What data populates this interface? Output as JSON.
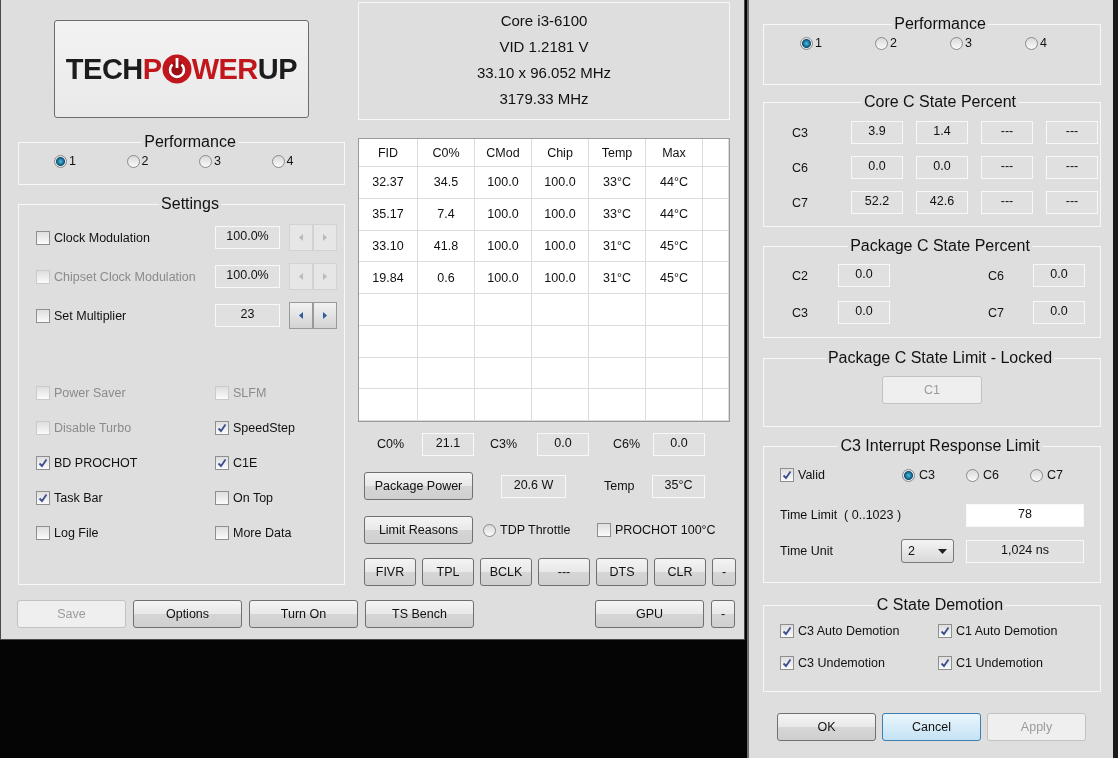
{
  "main_window": {
    "logo": {
      "left": [
        {
          "text": "TECH",
          "color": "#1c1c1c"
        },
        {
          "text": "P",
          "color": "#c1161c"
        }
      ],
      "right": [
        {
          "text": "WER",
          "color": "#c1161c"
        },
        {
          "text": "UP",
          "color": "#1c1c1c"
        }
      ]
    },
    "cpu_info": [
      "Core i3-6100",
      "VID  1.2181 V",
      "33.10 x 96.052 MHz",
      "3179.33 MHz"
    ],
    "performance": {
      "title": "Performance",
      "options": [
        {
          "label": "1",
          "selected": true
        },
        {
          "label": "2",
          "selected": false
        },
        {
          "label": "3",
          "selected": false
        },
        {
          "label": "4",
          "selected": false
        }
      ]
    },
    "settings": {
      "title": "Settings",
      "rows": [
        {
          "label": "Clock Modulation",
          "checked": false,
          "disabled": false,
          "value": "100.0%",
          "spinner_disabled": true
        },
        {
          "label": "Chipset Clock Modulation",
          "checked": false,
          "disabled": true,
          "value": "100.0%",
          "spinner_disabled": true
        },
        {
          "label": "Set Multiplier",
          "checked": false,
          "disabled": false,
          "value": "23",
          "spinner_disabled": false
        }
      ],
      "toggles": [
        {
          "label": "Power Saver",
          "checked": false,
          "disabled": true
        },
        {
          "label": "SLFM",
          "checked": false,
          "disabled": true
        },
        {
          "label": "Disable Turbo",
          "checked": false,
          "disabled": true
        },
        {
          "label": "SpeedStep",
          "checked": true,
          "disabled": false
        },
        {
          "label": "BD PROCHOT",
          "checked": true,
          "disabled": false
        },
        {
          "label": "C1E",
          "checked": true,
          "disabled": false
        },
        {
          "label": "Task Bar",
          "checked": true,
          "disabled": false
        },
        {
          "label": "On Top",
          "checked": false,
          "disabled": false
        },
        {
          "label": "Log File",
          "checked": false,
          "disabled": false
        },
        {
          "label": "More Data",
          "checked": false,
          "disabled": false
        }
      ]
    },
    "table": {
      "columns": [
        "FID",
        "C0%",
        "CMod",
        "Chip",
        "Temp",
        "Max"
      ],
      "rows": [
        [
          "32.37",
          "34.5",
          "100.0",
          "100.0",
          "33°C",
          "44°C"
        ],
        [
          "35.17",
          "7.4",
          "100.0",
          "100.0",
          "33°C",
          "44°C"
        ],
        [
          "33.10",
          "41.8",
          "100.0",
          "100.0",
          "31°C",
          "45°C"
        ],
        [
          "19.84",
          "0.6",
          "100.0",
          "100.0",
          "31°C",
          "45°C"
        ]
      ]
    },
    "summary": [
      {
        "label": "C0%",
        "value": "21.1"
      },
      {
        "label": "C3%",
        "value": "0.0"
      },
      {
        "label": "C6%",
        "value": "0.0"
      }
    ],
    "package_power": {
      "button": "Package Power",
      "value": "20.6 W",
      "temp_label": "Temp",
      "temp_value": "35°C"
    },
    "limit_reasons": {
      "button": "Limit Reasons",
      "tdp_throttle": {
        "label": "TDP Throttle",
        "selected": false
      },
      "prochot": {
        "label": "PROCHOT 100°C",
        "checked": false
      }
    },
    "tool_buttons": [
      "FIVR",
      "TPL",
      "BCLK",
      "---",
      "DTS",
      "CLR",
      "-"
    ],
    "bottom_buttons": [
      {
        "label": "Save",
        "disabled": true
      },
      {
        "label": "Options",
        "disabled": false
      },
      {
        "label": "Turn On",
        "disabled": false
      },
      {
        "label": "TS Bench",
        "disabled": false
      }
    ],
    "bottom_right_buttons": [
      "GPU",
      "-"
    ]
  },
  "options_window": {
    "performance": {
      "title": "Performance",
      "options": [
        {
          "label": "1",
          "selected": true
        },
        {
          "label": "2",
          "selected": false
        },
        {
          "label": "3",
          "selected": false
        },
        {
          "label": "4",
          "selected": false
        }
      ]
    },
    "core_c_state": {
      "title": "Core C State Percent",
      "rows": [
        {
          "label": "C3",
          "values": [
            "3.9",
            "1.4",
            "---",
            "---"
          ]
        },
        {
          "label": "C6",
          "values": [
            "0.0",
            "0.0",
            "---",
            "---"
          ]
        },
        {
          "label": "C7",
          "values": [
            "52.2",
            "42.6",
            "---",
            "---"
          ]
        }
      ]
    },
    "package_c_state": {
      "title": "Package C State Percent",
      "items": [
        {
          "label": "C2",
          "value": "0.0"
        },
        {
          "label": "C6",
          "value": "0.0"
        },
        {
          "label": "C3",
          "value": "0.0"
        },
        {
          "label": "C7",
          "value": "0.0"
        }
      ]
    },
    "package_limit": {
      "title": "Package C State Limit - Locked",
      "value": "C1"
    },
    "interrupt": {
      "title": "C3 Interrupt Response Limit",
      "valid": {
        "label": "Valid",
        "checked": true
      },
      "states": [
        {
          "label": "C3",
          "selected": true
        },
        {
          "label": "C6",
          "selected": false
        },
        {
          "label": "C7",
          "selected": false
        }
      ],
      "time_limit": {
        "label": "Time Limit  ( 0..1023 )",
        "value": "78"
      },
      "time_unit": {
        "label": "Time Unit",
        "value": "2",
        "reading": "1,024 ns"
      }
    },
    "demotion": {
      "title": "C State Demotion",
      "items": [
        {
          "label": "C3 Auto Demotion",
          "checked": true
        },
        {
          "label": "C1 Auto Demotion",
          "checked": true
        },
        {
          "label": "C3 Undemotion",
          "checked": true
        },
        {
          "label": "C1 Undemotion",
          "checked": true
        }
      ]
    },
    "buttons": [
      {
        "label": "OK",
        "focused": false,
        "disabled": false
      },
      {
        "label": "Cancel",
        "focused": true,
        "disabled": false
      },
      {
        "label": "Apply",
        "focused": false,
        "disabled": true
      }
    ]
  }
}
